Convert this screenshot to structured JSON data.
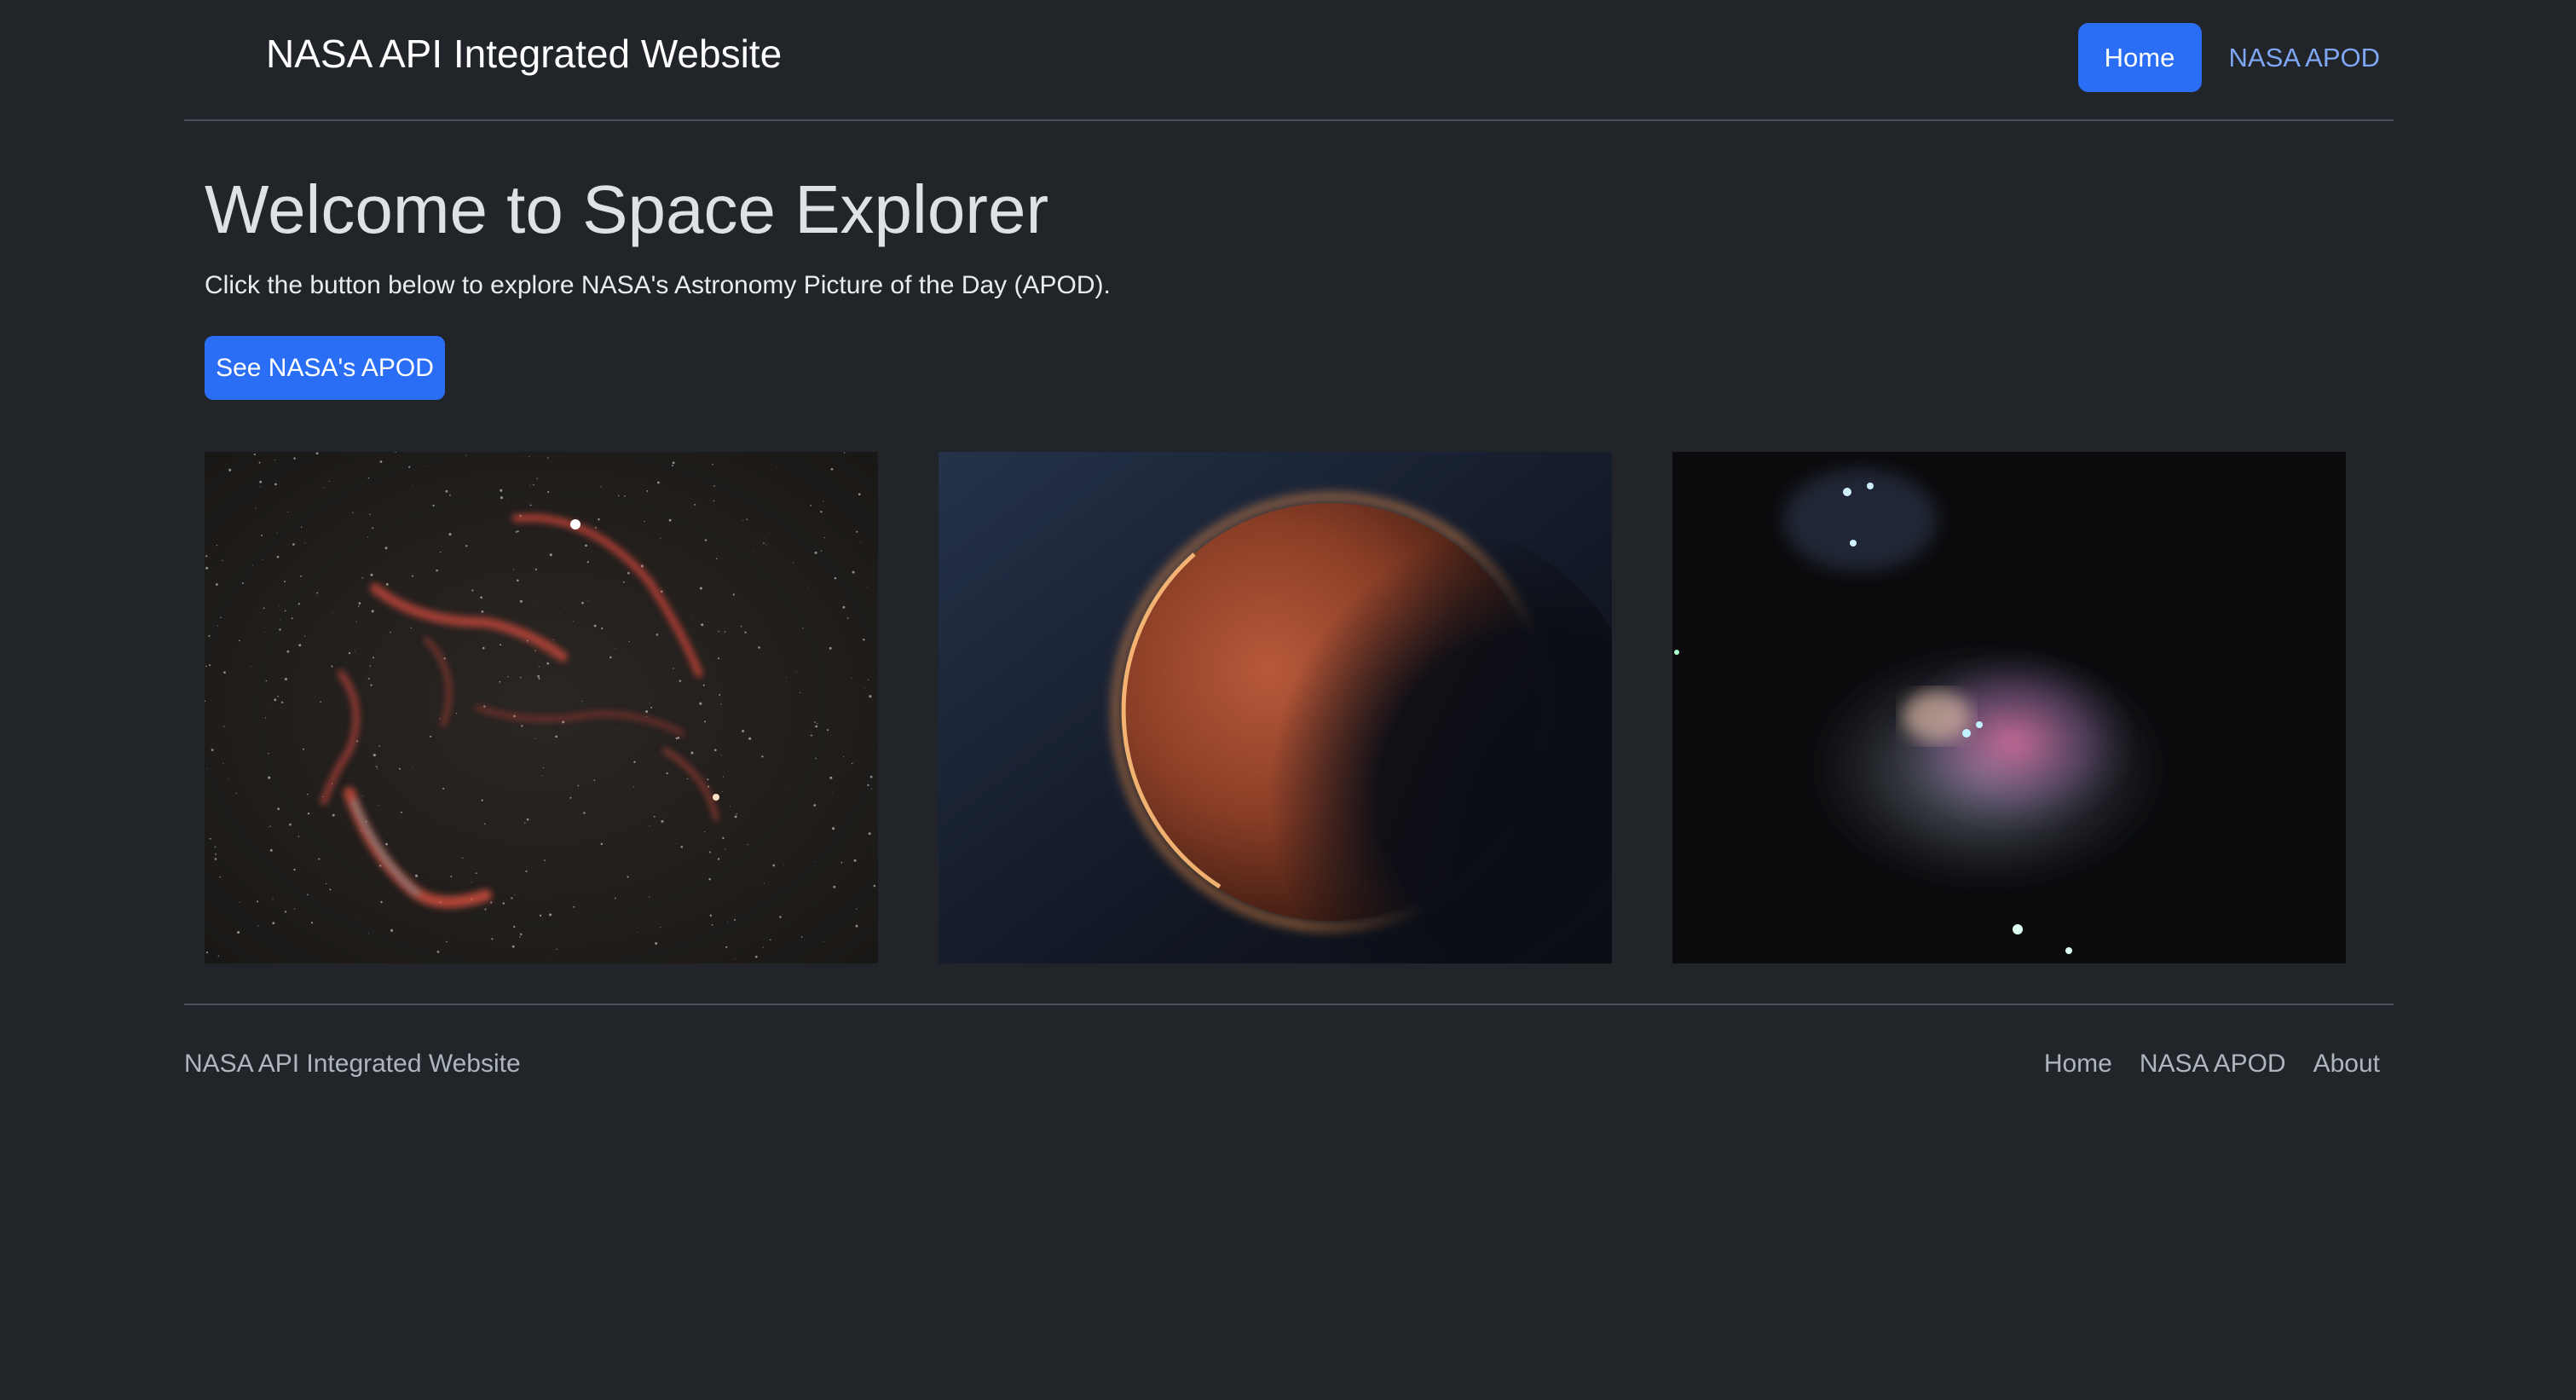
{
  "header": {
    "brand": "NASA API Integrated Website",
    "nav": {
      "home": "Home",
      "apod": "NASA APOD"
    }
  },
  "hero": {
    "title": "Welcome to Space Explorer",
    "lead": "Click the button below to explore NASA's Astronomy Picture of the Day (APOD).",
    "button": "See NASA's APOD"
  },
  "footer": {
    "brand": "NASA API Integrated Website",
    "links": [
      "Home",
      "NASA APOD",
      "About"
    ]
  },
  "colors": {
    "background": "#212529",
    "primary": "#2b6ef6",
    "link": "#7fa7f5",
    "muted": "#adb5bd"
  }
}
